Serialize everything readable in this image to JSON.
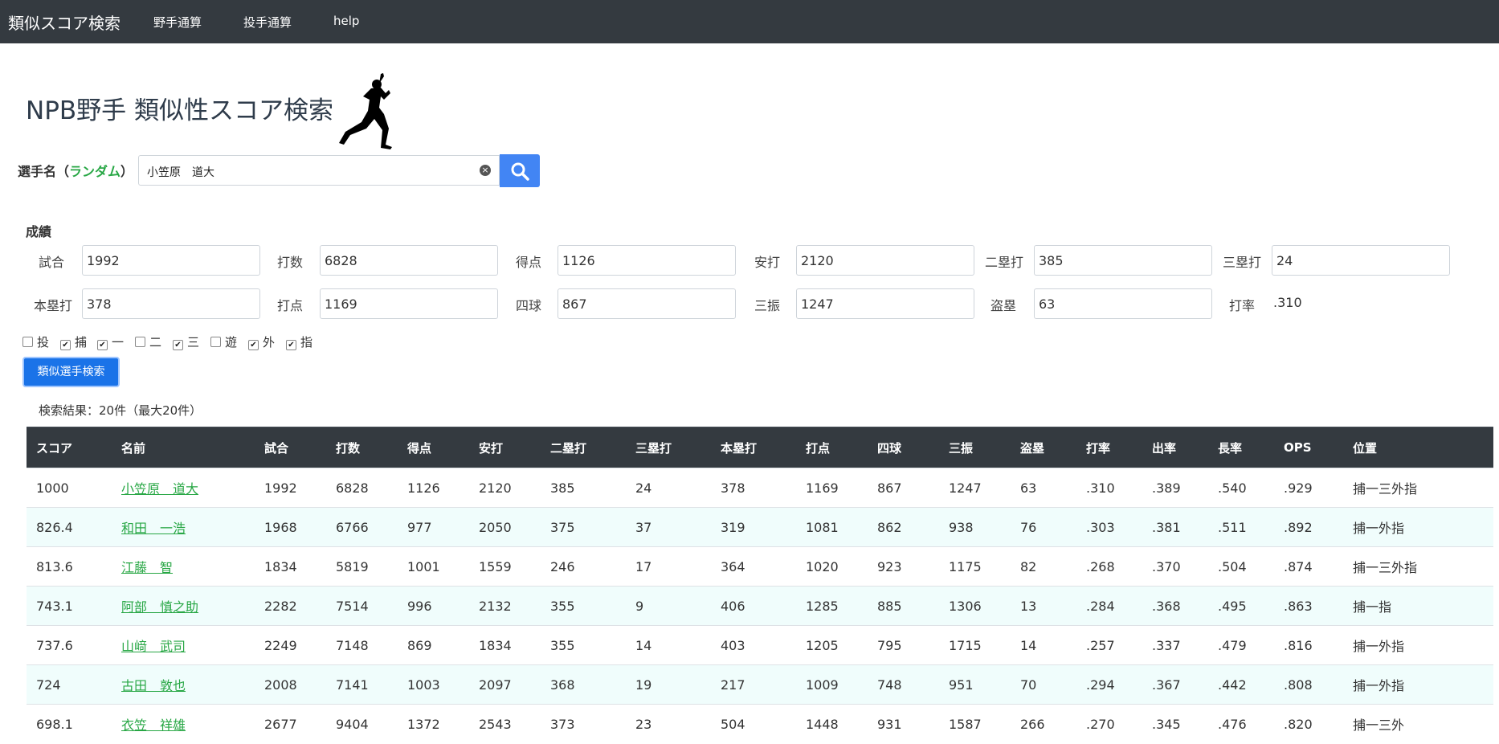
{
  "navbar": {
    "brand": "類似スコア検索",
    "links": [
      "野手通算",
      "投手通算",
      "help"
    ]
  },
  "page_title": "NPB野手 類似性スコア検索",
  "search": {
    "label_prefix": "選手名（",
    "random_label": "ランダム",
    "label_suffix": "）",
    "value": "小笠原　道大",
    "clear_icon": "×"
  },
  "stats": {
    "section_label": "成績",
    "fields": [
      {
        "label": "試合",
        "value": "1992"
      },
      {
        "label": "打数",
        "value": "6828"
      },
      {
        "label": "得点",
        "value": "1126"
      },
      {
        "label": "安打",
        "value": "2120"
      },
      {
        "label": "二塁打",
        "value": "385"
      },
      {
        "label": "三塁打",
        "value": "24"
      },
      {
        "label": "本塁打",
        "value": "378"
      },
      {
        "label": "打点",
        "value": "1169"
      },
      {
        "label": "四球",
        "value": "867"
      },
      {
        "label": "三振",
        "value": "1247"
      },
      {
        "label": "盗塁",
        "value": "63"
      }
    ],
    "avg_label": "打率",
    "avg_value": ".310"
  },
  "positions": [
    {
      "label": "投",
      "checked": false,
      "mark": ""
    },
    {
      "label": "捕",
      "checked": true,
      "mark": "✔"
    },
    {
      "label": "一",
      "checked": true,
      "mark": "✔"
    },
    {
      "label": "二",
      "checked": false,
      "mark": ""
    },
    {
      "label": "三",
      "checked": true,
      "mark": "✔"
    },
    {
      "label": "遊",
      "checked": false,
      "mark": ""
    },
    {
      "label": "外",
      "checked": true,
      "mark": "✔"
    },
    {
      "label": "指",
      "checked": true,
      "mark": "✔"
    }
  ],
  "search_button": "類似選手検索",
  "result_count": "検索結果：20件（最大20件）",
  "table": {
    "headers": [
      "スコア",
      "名前",
      "試合",
      "打数",
      "得点",
      "安打",
      "二塁打",
      "三塁打",
      "本塁打",
      "打点",
      "四球",
      "三振",
      "盗塁",
      "打率",
      "出率",
      "長率",
      "OPS",
      "位置"
    ],
    "rows": [
      [
        "1000",
        "小笠原　道大",
        "1992",
        "6828",
        "1126",
        "2120",
        "385",
        "24",
        "378",
        "1169",
        "867",
        "1247",
        "63",
        ".310",
        ".389",
        ".540",
        ".929",
        "捕一三外指"
      ],
      [
        "826.4",
        "和田　一浩",
        "1968",
        "6766",
        "977",
        "2050",
        "375",
        "37",
        "319",
        "1081",
        "862",
        "938",
        "76",
        ".303",
        ".381",
        ".511",
        ".892",
        "捕一外指"
      ],
      [
        "813.6",
        "江藤　智",
        "1834",
        "5819",
        "1001",
        "1559",
        "246",
        "17",
        "364",
        "1020",
        "923",
        "1175",
        "82",
        ".268",
        ".370",
        ".504",
        ".874",
        "捕一三外指"
      ],
      [
        "743.1",
        "阿部　慎之助",
        "2282",
        "7514",
        "996",
        "2132",
        "355",
        "9",
        "406",
        "1285",
        "885",
        "1306",
        "13",
        ".284",
        ".368",
        ".495",
        ".863",
        "捕一指"
      ],
      [
        "737.6",
        "山﨑　武司",
        "2249",
        "7148",
        "869",
        "1834",
        "355",
        "14",
        "403",
        "1205",
        "795",
        "1715",
        "14",
        ".257",
        ".337",
        ".479",
        ".816",
        "捕一外指"
      ],
      [
        "724",
        "古田　敦也",
        "2008",
        "7141",
        "1003",
        "2097",
        "368",
        "19",
        "217",
        "1009",
        "748",
        "951",
        "70",
        ".294",
        ".367",
        ".442",
        ".808",
        "捕一外指"
      ],
      [
        "698.1",
        "衣笠　祥雄",
        "2677",
        "9404",
        "1372",
        "2543",
        "373",
        "23",
        "504",
        "1448",
        "931",
        "1587",
        "266",
        ".270",
        ".345",
        ".476",
        ".820",
        "捕一三外"
      ]
    ]
  }
}
